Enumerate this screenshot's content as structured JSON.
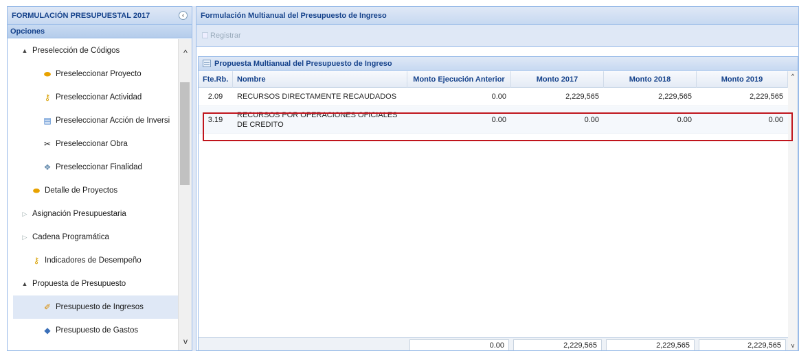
{
  "left": {
    "title": "FORMULACIÓN PRESUPUESTAL 2017",
    "collapse_icon": "‹",
    "options_label": "Opciones",
    "tree": [
      {
        "label": "Preselección de Códigos",
        "expander": "▲",
        "icon": ""
      },
      {
        "label": "Preseleccionar Proyecto",
        "expander": "",
        "icon": "coin-icon"
      },
      {
        "label": "Preseleccionar Actividad",
        "expander": "",
        "icon": "key-icon"
      },
      {
        "label": "Preseleccionar Acción de Inversi",
        "expander": "",
        "icon": "chart-icon"
      },
      {
        "label": "Preseleccionar Obra",
        "expander": "",
        "icon": "tools-icon"
      },
      {
        "label": "Preseleccionar Finalidad",
        "expander": "",
        "icon": "puzzle-icon"
      },
      {
        "label": "Detalle de Proyectos",
        "expander": "",
        "icon": "coin-icon"
      },
      {
        "label": "Asignación Presupuestaria",
        "expander": "▷",
        "icon": ""
      },
      {
        "label": "Cadena Programática",
        "expander": "▷",
        "icon": ""
      },
      {
        "label": "Indicadores de Desempeño",
        "expander": "",
        "icon": "key-icon"
      },
      {
        "label": "Propuesta de Presupuesto",
        "expander": "▲",
        "icon": ""
      },
      {
        "label": "Presupuesto de Ingresos",
        "expander": "",
        "icon": "income-icon"
      },
      {
        "label": "Presupuesto de Gastos",
        "expander": "",
        "icon": "expense-icon"
      }
    ]
  },
  "right": {
    "title": "Formulación Multianual del Presupuesto de Ingreso",
    "toolbar": {
      "registrar_label": "Registrar"
    },
    "grid": {
      "title": "Propuesta Multianual del Presupuesto de Ingreso",
      "columns": [
        "Fte.Rb.",
        "Nombre",
        "Monto Ejecución Anterior",
        "Monto 2017",
        "Monto 2018",
        "Monto 2019"
      ],
      "rows": [
        {
          "fte": "2.09",
          "nombre": "RECURSOS DIRECTAMENTE RECAUDADOS",
          "anterior": "0.00",
          "m2017": "2,229,565",
          "m2018": "2,229,565",
          "m2019": "2,229,565"
        },
        {
          "fte": "3.19",
          "nombre": "RECURSOS POR OPERACIONES OFICIALES DE CREDITO",
          "anterior": "0.00",
          "m2017": "0.00",
          "m2018": "0.00",
          "m2019": "0.00"
        }
      ],
      "totals": {
        "anterior": "0.00",
        "m2017": "2,229,565",
        "m2018": "2,229,565",
        "m2019": "2,229,565"
      }
    }
  },
  "colors": {
    "highlight": "#c0141c",
    "header_text": "#15428b",
    "panel_border": "#99bbe8"
  }
}
